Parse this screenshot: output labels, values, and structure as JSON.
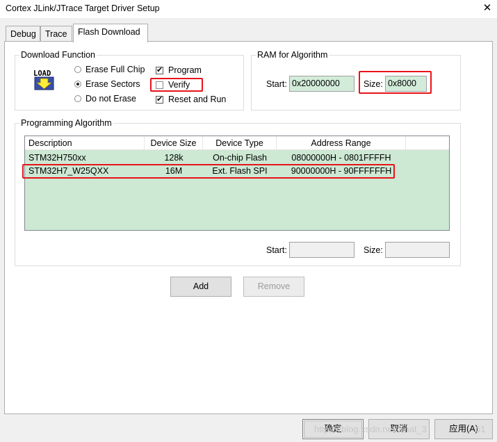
{
  "window": {
    "title": "Cortex JLink/JTrace Target Driver Setup",
    "close_glyph": "✕"
  },
  "tabs": [
    {
      "label": "Debug"
    },
    {
      "label": "Trace"
    },
    {
      "label": "Flash Download",
      "active": true
    }
  ],
  "download_function": {
    "legend": "Download Function",
    "load_icon_text": "LOAD",
    "options": [
      {
        "label": "Erase Full Chip",
        "selected": false
      },
      {
        "label": "Erase Sectors",
        "selected": true
      },
      {
        "label": "Do not Erase",
        "selected": false
      }
    ],
    "checks": [
      {
        "label": "Program",
        "checked": true
      },
      {
        "label": "Verify",
        "checked": false
      },
      {
        "label": "Reset and Run",
        "checked": true
      }
    ],
    "check_glyph": "✔"
  },
  "ram_for_algorithm": {
    "legend": "RAM for Algorithm",
    "start_label": "Start:",
    "start_value": "0x20000000",
    "size_label": "Size:",
    "size_value": "0x8000"
  },
  "programming_algorithm": {
    "legend": "Programming Algorithm",
    "columns": [
      "Description",
      "Device Size",
      "Device Type",
      "Address Range"
    ],
    "rows": [
      {
        "description": "STM32H750xx",
        "size": "128k",
        "type": "On-chip Flash",
        "range": "08000000H - 0801FFFFH"
      },
      {
        "description": "STM32H7_W25QXX",
        "size": "16M",
        "type": "Ext. Flash SPI",
        "range": "90000000H - 90FFFFFFH"
      }
    ],
    "start_label": "Start:",
    "start_value": "",
    "size_label": "Size:",
    "size_value": ""
  },
  "buttons": {
    "add": "Add",
    "remove": "Remove"
  },
  "footer": {
    "ok": "确定",
    "cancel": "取消",
    "apply": "应用(A)",
    "watermark": "https://blog.csdn.net/sinat_3",
    "watermark_tail": "61"
  },
  "colors": {
    "highlight_border": "#e8131a",
    "field_bg": "#d3ecd9",
    "list_bg": "#cde8d3"
  }
}
